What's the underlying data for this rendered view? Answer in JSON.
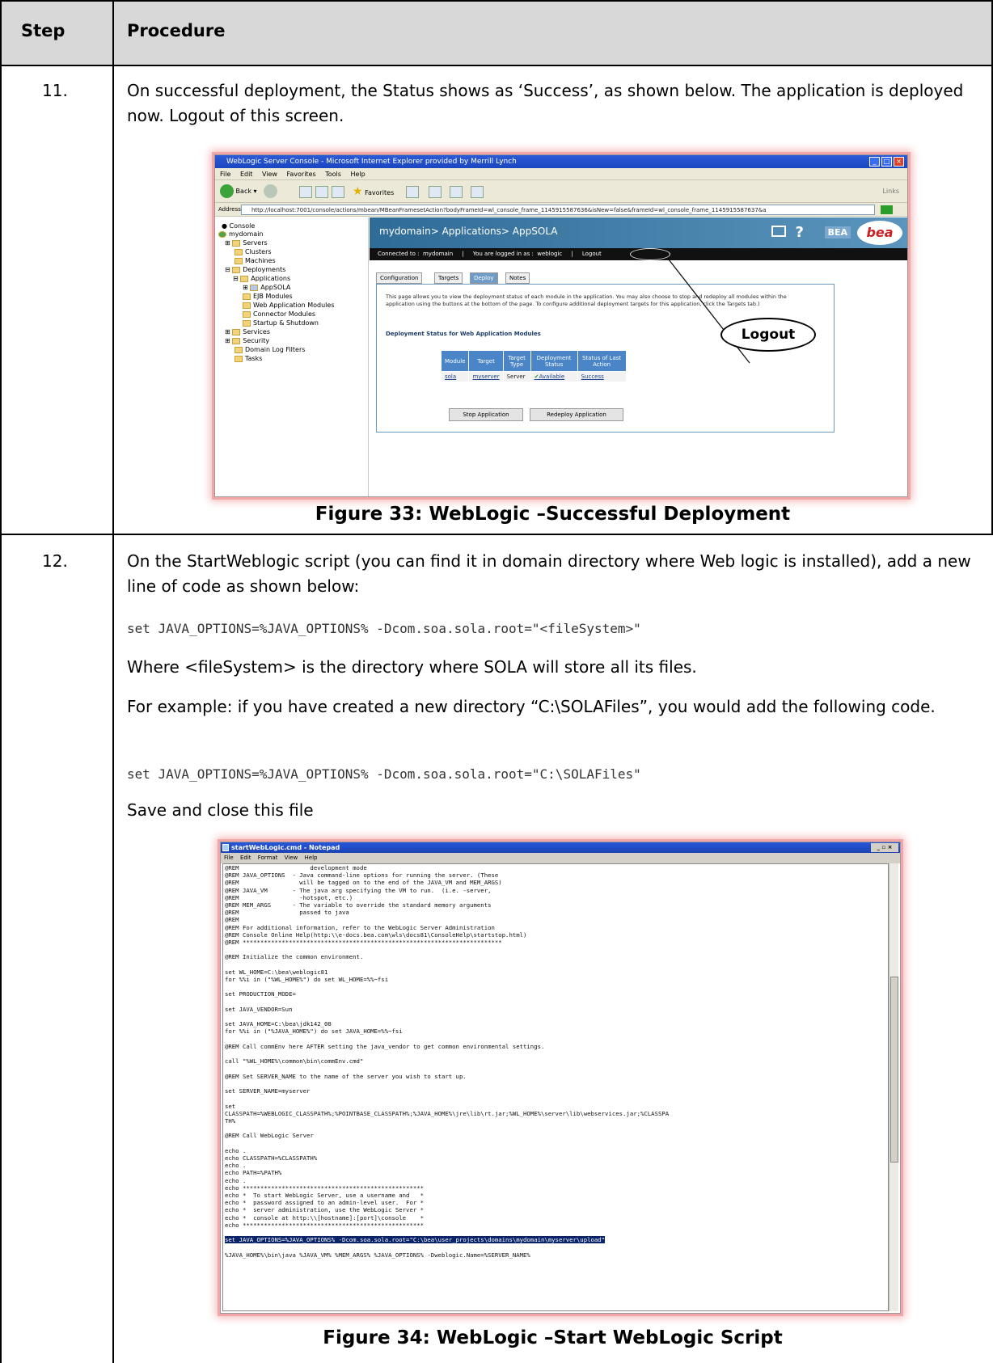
{
  "table": {
    "header_step": "Step",
    "header_procedure": "Procedure"
  },
  "rows": [
    {
      "step": "11.",
      "text": "On successful deployment, the Status shows as ‘Success’, as shown below.  The application is deployed now. Logout of this screen.",
      "caption": "Figure 33: WebLogic –Successful Deployment"
    },
    {
      "step": "12.",
      "text1": "On the StartWeblogic script (you can find it in domain directory where Web logic is installed), add a new line of code as shown below:",
      "code1": "set JAVA_OPTIONS=%JAVA_OPTIONS% -Dcom.soa.sola.root=\"<fileSystem>\"",
      "text2": "Where <fileSystem> is the directory where SOLA will store all its files.",
      "text3": "For example: if you have created a new directory “C:\\SOLAFiles”, you would add the following code.",
      "code2": "set JAVA_OPTIONS=%JAVA_OPTIONS% -Dcom.soa.sola.root=\"C:\\SOLAFiles\"",
      "text4": "Save and close this file",
      "caption": "Figure 34: WebLogic –Start WebLogic Script"
    }
  ],
  "fig33": {
    "window_title": "WebLogic Server Console - Microsoft Internet Explorer provided by Merrill Lynch",
    "menu": [
      "File",
      "Edit",
      "View",
      "Favorites",
      "Tools",
      "Help"
    ],
    "toolbar": {
      "back": "Back",
      "favorites": "Favorites",
      "links": "Links"
    },
    "address_label": "Address",
    "address": "http://localhost:7001/console/actions/mbean/MBeanFramesetAction?bodyFrameId=wl_console_frame_1145915587636&isNew=false&frameId=wl_console_frame_1145915587637&a",
    "tree": [
      "Console",
      "mydomain",
      "Servers",
      "Clusters",
      "Machines",
      "Deployments",
      "Applications",
      "AppSOLA",
      "EJB Modules",
      "Web Application Modules",
      "Connector Modules",
      "Startup & Shutdown",
      "Services",
      "Security",
      "Domain Log Filters",
      "Tasks"
    ],
    "breadcrumb": "mydomain> Applications> AppSOLA",
    "brand": "BEA",
    "logo": "bea",
    "status_bar": "Connected to :  mydomain     |     You are logged in as :  weblogic     |     Logout",
    "tabs": [
      "Configuration",
      "Targets",
      "Deploy",
      "Notes"
    ],
    "description": "This page allows you to view the deployment status of each module in the application. You may also choose to stop and redeploy all modules within the application using the buttons at the bottom of the page. To configure additional deployment targets for this application, click the Targets tab.)",
    "section_title": "Deployment Status for Web Application Modules",
    "columns": [
      "Module",
      "Target",
      "Target Type",
      "Deployment Status",
      "Status of Last Action"
    ],
    "row": [
      "sola",
      "myserver",
      "Server",
      "Available",
      "Success"
    ],
    "buttons": [
      "Stop Application",
      "Redeploy Application"
    ],
    "callout": "Logout"
  },
  "fig34": {
    "window_title": "startWebLogic.cmd - Notepad",
    "menu": [
      "File",
      "Edit",
      "Format",
      "View",
      "Help"
    ],
    "lines": [
      "@REM                    development mode",
      "@REM JAVA_OPTIONS  - Java command-line options for running the server. (These",
      "@REM                 will be tagged on to the end of the JAVA_VM and MEM_ARGS)",
      "@REM JAVA_VM       - The java arg specifying the VM to run.  (i.e. -server,",
      "@REM                 -hotspot, etc.)",
      "@REM MEM_ARGS      - The variable to override the standard memory arguments",
      "@REM                 passed to java",
      "@REM",
      "@REM For additional information, refer to the WebLogic Server Administration",
      "@REM Console Online Help(http:\\\\e-docs.bea.com\\wls\\docs81\\ConsoleHelp\\startstop.html)",
      "@REM *************************************************************************",
      "",
      "@REM Initialize the common environment.",
      "",
      "set WL_HOME=C:\\bea\\weblogic81",
      "for %%i in (\"%WL_HOME%\") do set WL_HOME=%%~fsi",
      "",
      "set PRODUCTION_MODE=",
      "",
      "set JAVA_VENDOR=Sun",
      "",
      "set JAVA_HOME=C:\\bea\\jdk142_08",
      "for %%i in (\"%JAVA_HOME%\") do set JAVA_HOME=%%~fsi",
      "",
      "@REM Call commEnv here AFTER setting the java_vendor to get common environmental settings.",
      "",
      "call \"%WL_HOME%\\common\\bin\\commEnv.cmd\"",
      "",
      "@REM Set SERVER_NAME to the name of the server you wish to start up.",
      "",
      "set SERVER_NAME=myserver",
      "",
      "set",
      "CLASSPATH=%WEBLOGIC_CLASSPATH%;%POINTBASE_CLASSPATH%;%JAVA_HOME%\\jre\\lib\\rt.jar;%WL_HOME%\\server\\lib\\webservices.jar;%CLASSPA",
      "TH%",
      "",
      "@REM Call WebLogic Server",
      "",
      "echo .",
      "echo CLASSPATH=%CLASSPATH%",
      "echo .",
      "echo PATH=%PATH%",
      "echo .",
      "echo ***************************************************",
      "echo *  To start WebLogic Server, use a username and   *",
      "echo *  password assigned to an admin-level user.  For *",
      "echo *  server administration, use the WebLogic Server *",
      "echo *  console at http:\\\\[hostname]:[port]\\console    *",
      "echo ***************************************************",
      "",
      "set JAVA_OPTIONS=%JAVA_OPTIONS% -Dcom.soa.sola.root=\"C:\\bea\\user_projects\\domains\\mydomain\\myserver\\upload\"",
      "",
      "%JAVA_HOME%\\bin\\java %JAVA_VM% %MEM_ARGS% %JAVA_OPTIONS% -Dweblogic.Name=%SERVER_NAME%"
    ],
    "highlight_index": 50
  }
}
